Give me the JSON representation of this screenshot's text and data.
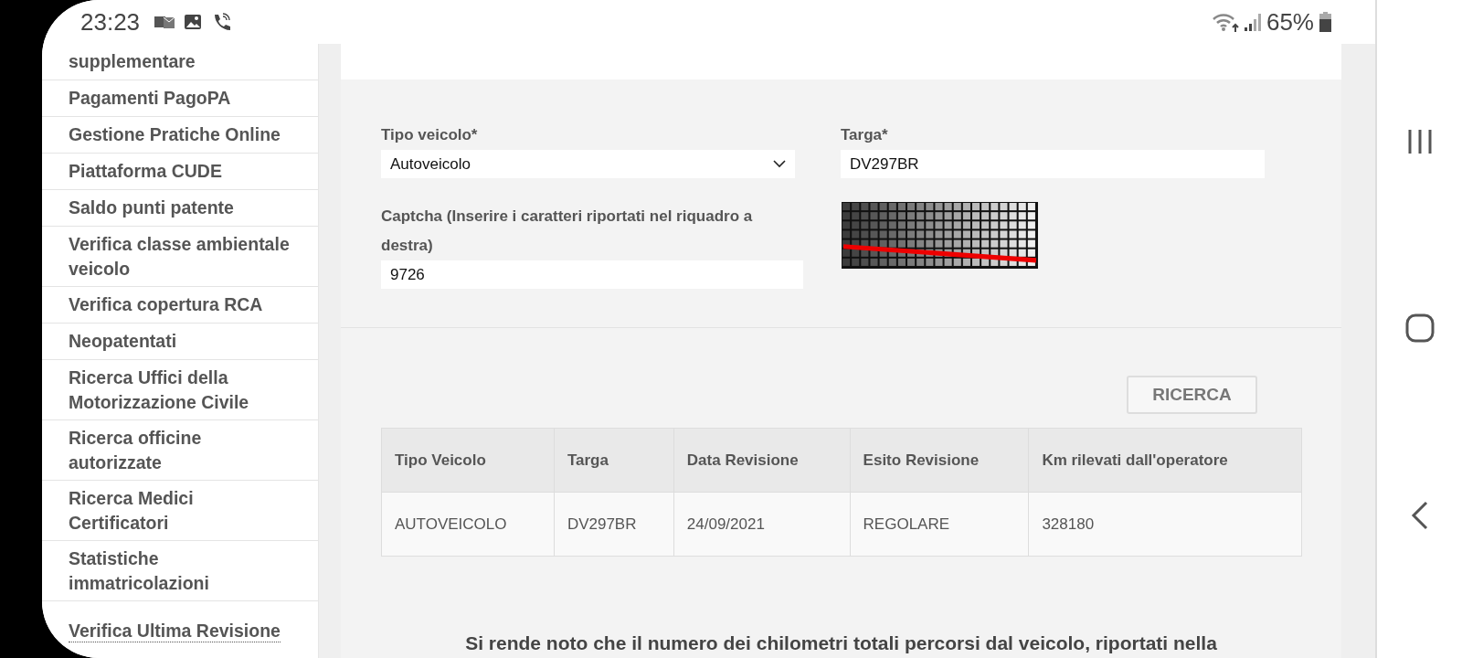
{
  "status_bar": {
    "time": "23:23",
    "battery": "65%"
  },
  "sidebar": {
    "items": [
      {
        "label": "supplementare",
        "selected": false
      },
      {
        "label": "Pagamenti PagoPA",
        "selected": false
      },
      {
        "label": "Gestione Pratiche Online",
        "selected": false
      },
      {
        "label": "Piattaforma CUDE",
        "selected": false
      },
      {
        "label": "Saldo punti patente",
        "selected": false
      },
      {
        "label": "Verifica classe ambientale veicolo",
        "selected": false
      },
      {
        "label": "Verifica copertura RCA",
        "selected": false
      },
      {
        "label": "Neopatentati",
        "selected": false
      },
      {
        "label": "Ricerca Uffici della Motorizzazione Civile",
        "selected": false
      },
      {
        "label": "Ricerca officine autorizzate",
        "selected": false
      },
      {
        "label": "Ricerca Medici Certificatori",
        "selected": false
      },
      {
        "label": "Statistiche immatricolazioni",
        "selected": false
      },
      {
        "label": "Verifica Ultima Revisione",
        "selected": true
      }
    ]
  },
  "form": {
    "fields": [
      {
        "kind": "select",
        "label": "Tipo veicolo*",
        "value": "Autoveicolo"
      },
      {
        "kind": "text",
        "label": "Targa*",
        "value": "DV297BR"
      },
      {
        "kind": "text",
        "label": "Captcha (Inserire i caratteri riportati nel riquadro a destra)",
        "value": "9726"
      }
    ]
  },
  "search_button": "RICERCA",
  "table": {
    "columns": [
      "Tipo Veicolo",
      "Targa",
      "Data Revisione",
      "Esito Revisione",
      "Km rilevati dall'operatore"
    ],
    "rows": [
      [
        "AUTOVEICOLO",
        "DV297BR",
        "24/09/2021",
        "REGOLARE",
        "328180"
      ]
    ]
  },
  "notice": "Si rende noto che il numero dei chilometri totali percorsi dal veicolo, riportati nella"
}
